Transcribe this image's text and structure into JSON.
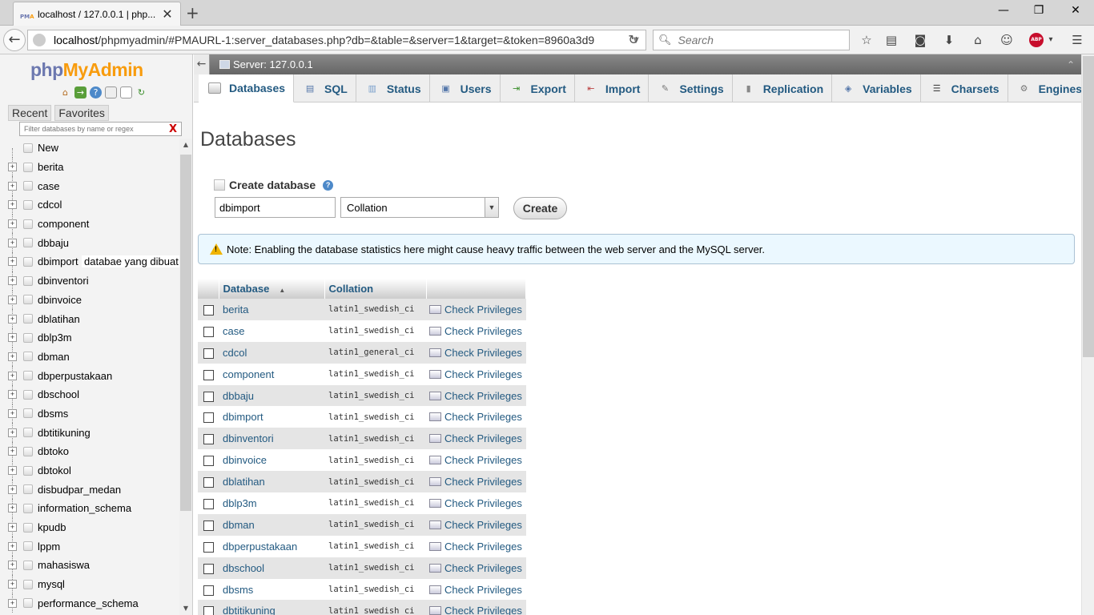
{
  "browser": {
    "tab_title": "localhost / 127.0.0.1 | php...",
    "tab_favicon": "PMA",
    "url_host": "localhost",
    "url_path": "/phpmyadmin/#PMAURL-1:server_databases.php?db=&table=&server=1&target=&token=8960a3d9",
    "search_placeholder": "Search",
    "abp_label": "ABP"
  },
  "nav": {
    "logo_php": "php",
    "logo_myadmin": "MyAdmin",
    "recent_label": "Recent",
    "favorites_label": "Favorites",
    "filter_placeholder": "Filter databases by name or regex",
    "filter_clear": "X",
    "new_label": "New",
    "annotation": "databae yang dibuat",
    "databases": [
      "berita",
      "case",
      "cdcol",
      "component",
      "dbbaju",
      "dbimport",
      "dbinventori",
      "dbinvoice",
      "dblatihan",
      "dblp3m",
      "dbman",
      "dbperpustakaan",
      "dbschool",
      "dbsms",
      "dbtitikuning",
      "dbtoko",
      "dbtokol",
      "disbudpar_medan",
      "information_schema",
      "kpudb",
      "lppm",
      "mahasiswa",
      "mysql",
      "performance_schema"
    ]
  },
  "main": {
    "server_label": "Server: 127.0.0.1",
    "tabs": [
      {
        "label": "Databases",
        "icon": "database-icon"
      },
      {
        "label": "SQL",
        "icon": "sql-icon"
      },
      {
        "label": "Status",
        "icon": "status-icon"
      },
      {
        "label": "Users",
        "icon": "users-icon"
      },
      {
        "label": "Export",
        "icon": "export-icon"
      },
      {
        "label": "Import",
        "icon": "import-icon"
      },
      {
        "label": "Settings",
        "icon": "settings-icon"
      },
      {
        "label": "Replication",
        "icon": "replication-icon"
      },
      {
        "label": "Variables",
        "icon": "variables-icon"
      },
      {
        "label": "Charsets",
        "icon": "charsets-icon"
      },
      {
        "label": "Engines",
        "icon": "engines-icon"
      }
    ],
    "page_title": "Databases",
    "create_label": "Create database",
    "db_name_value": "dbimport",
    "collation_value": "Collation",
    "create_button": "Create",
    "notice": "Note: Enabling the database statistics here might cause heavy traffic between the web server and the MySQL server.",
    "table": {
      "col_database": "Database",
      "col_collation": "Collation",
      "privileges_label": "Check Privileges",
      "rows": [
        {
          "name": "berita",
          "collation": "latin1_swedish_ci"
        },
        {
          "name": "case",
          "collation": "latin1_swedish_ci"
        },
        {
          "name": "cdcol",
          "collation": "latin1_general_ci"
        },
        {
          "name": "component",
          "collation": "latin1_swedish_ci"
        },
        {
          "name": "dbbaju",
          "collation": "latin1_swedish_ci"
        },
        {
          "name": "dbimport",
          "collation": "latin1_swedish_ci"
        },
        {
          "name": "dbinventori",
          "collation": "latin1_swedish_ci"
        },
        {
          "name": "dbinvoice",
          "collation": "latin1_swedish_ci"
        },
        {
          "name": "dblatihan",
          "collation": "latin1_swedish_ci"
        },
        {
          "name": "dblp3m",
          "collation": "latin1_swedish_ci"
        },
        {
          "name": "dbman",
          "collation": "latin1_swedish_ci"
        },
        {
          "name": "dbperpustakaan",
          "collation": "latin1_swedish_ci"
        },
        {
          "name": "dbschool",
          "collation": "latin1_swedish_ci"
        },
        {
          "name": "dbsms",
          "collation": "latin1_swedish_ci"
        },
        {
          "name": "dbtitikuning",
          "collation": "latin1_swedish_ci"
        }
      ]
    }
  },
  "colors": {
    "link": "#235a81",
    "logo_blue": "#6c78af",
    "logo_orange": "#f89c0e",
    "notice_bg": "#ebf8ff"
  }
}
